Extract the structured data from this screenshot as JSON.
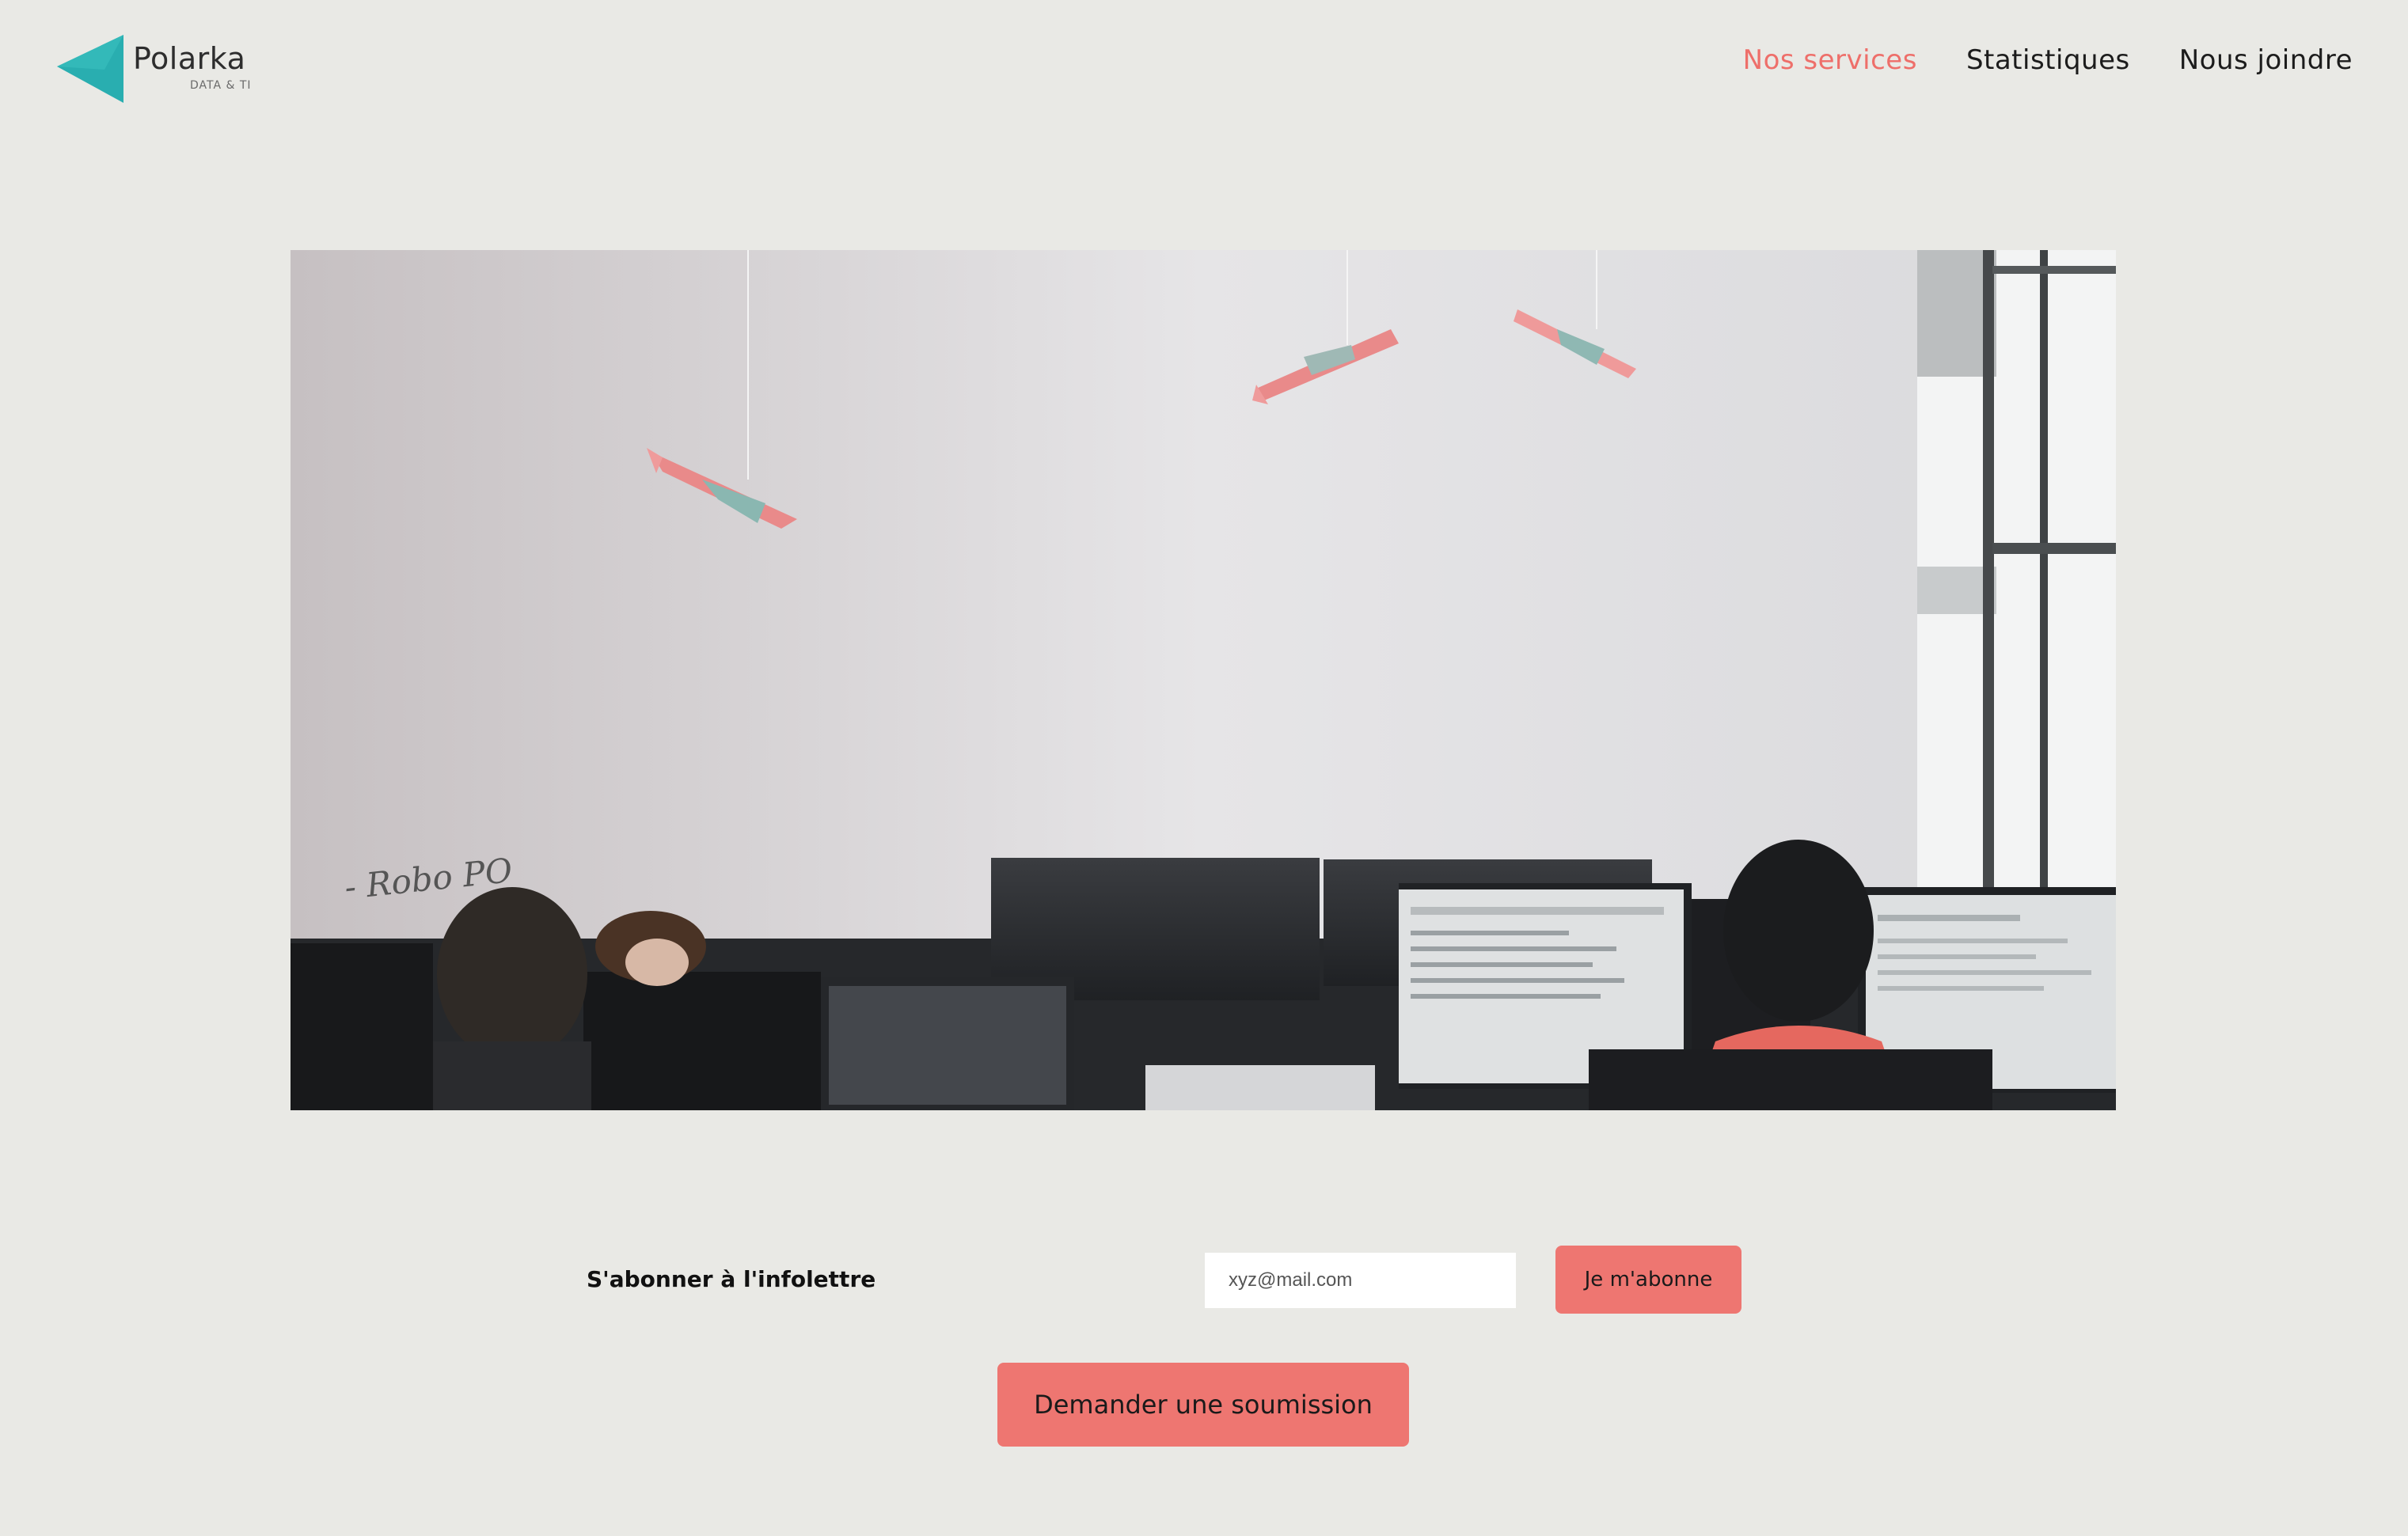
{
  "brand": {
    "name": "Polarka",
    "tagline": "DATA & TI",
    "accent_color": "#ee6f6a",
    "logo_color": "#29aeb0"
  },
  "nav": {
    "items": [
      {
        "label": "Nos services",
        "active": true
      },
      {
        "label": "Statistiques",
        "active": false
      },
      {
        "label": "Nous joindre",
        "active": false
      }
    ]
  },
  "hero": {
    "whiteboard_text": "- Robo PO"
  },
  "newsletter": {
    "label": "S'abonner à l'infolettre",
    "email_placeholder": "xyz@mail.com",
    "subscribe_label": "Je m'abonne"
  },
  "cta": {
    "quote_label": "Demander une soumission"
  },
  "colors": {
    "background": "#e9e9e5",
    "button": "#ee7671"
  }
}
